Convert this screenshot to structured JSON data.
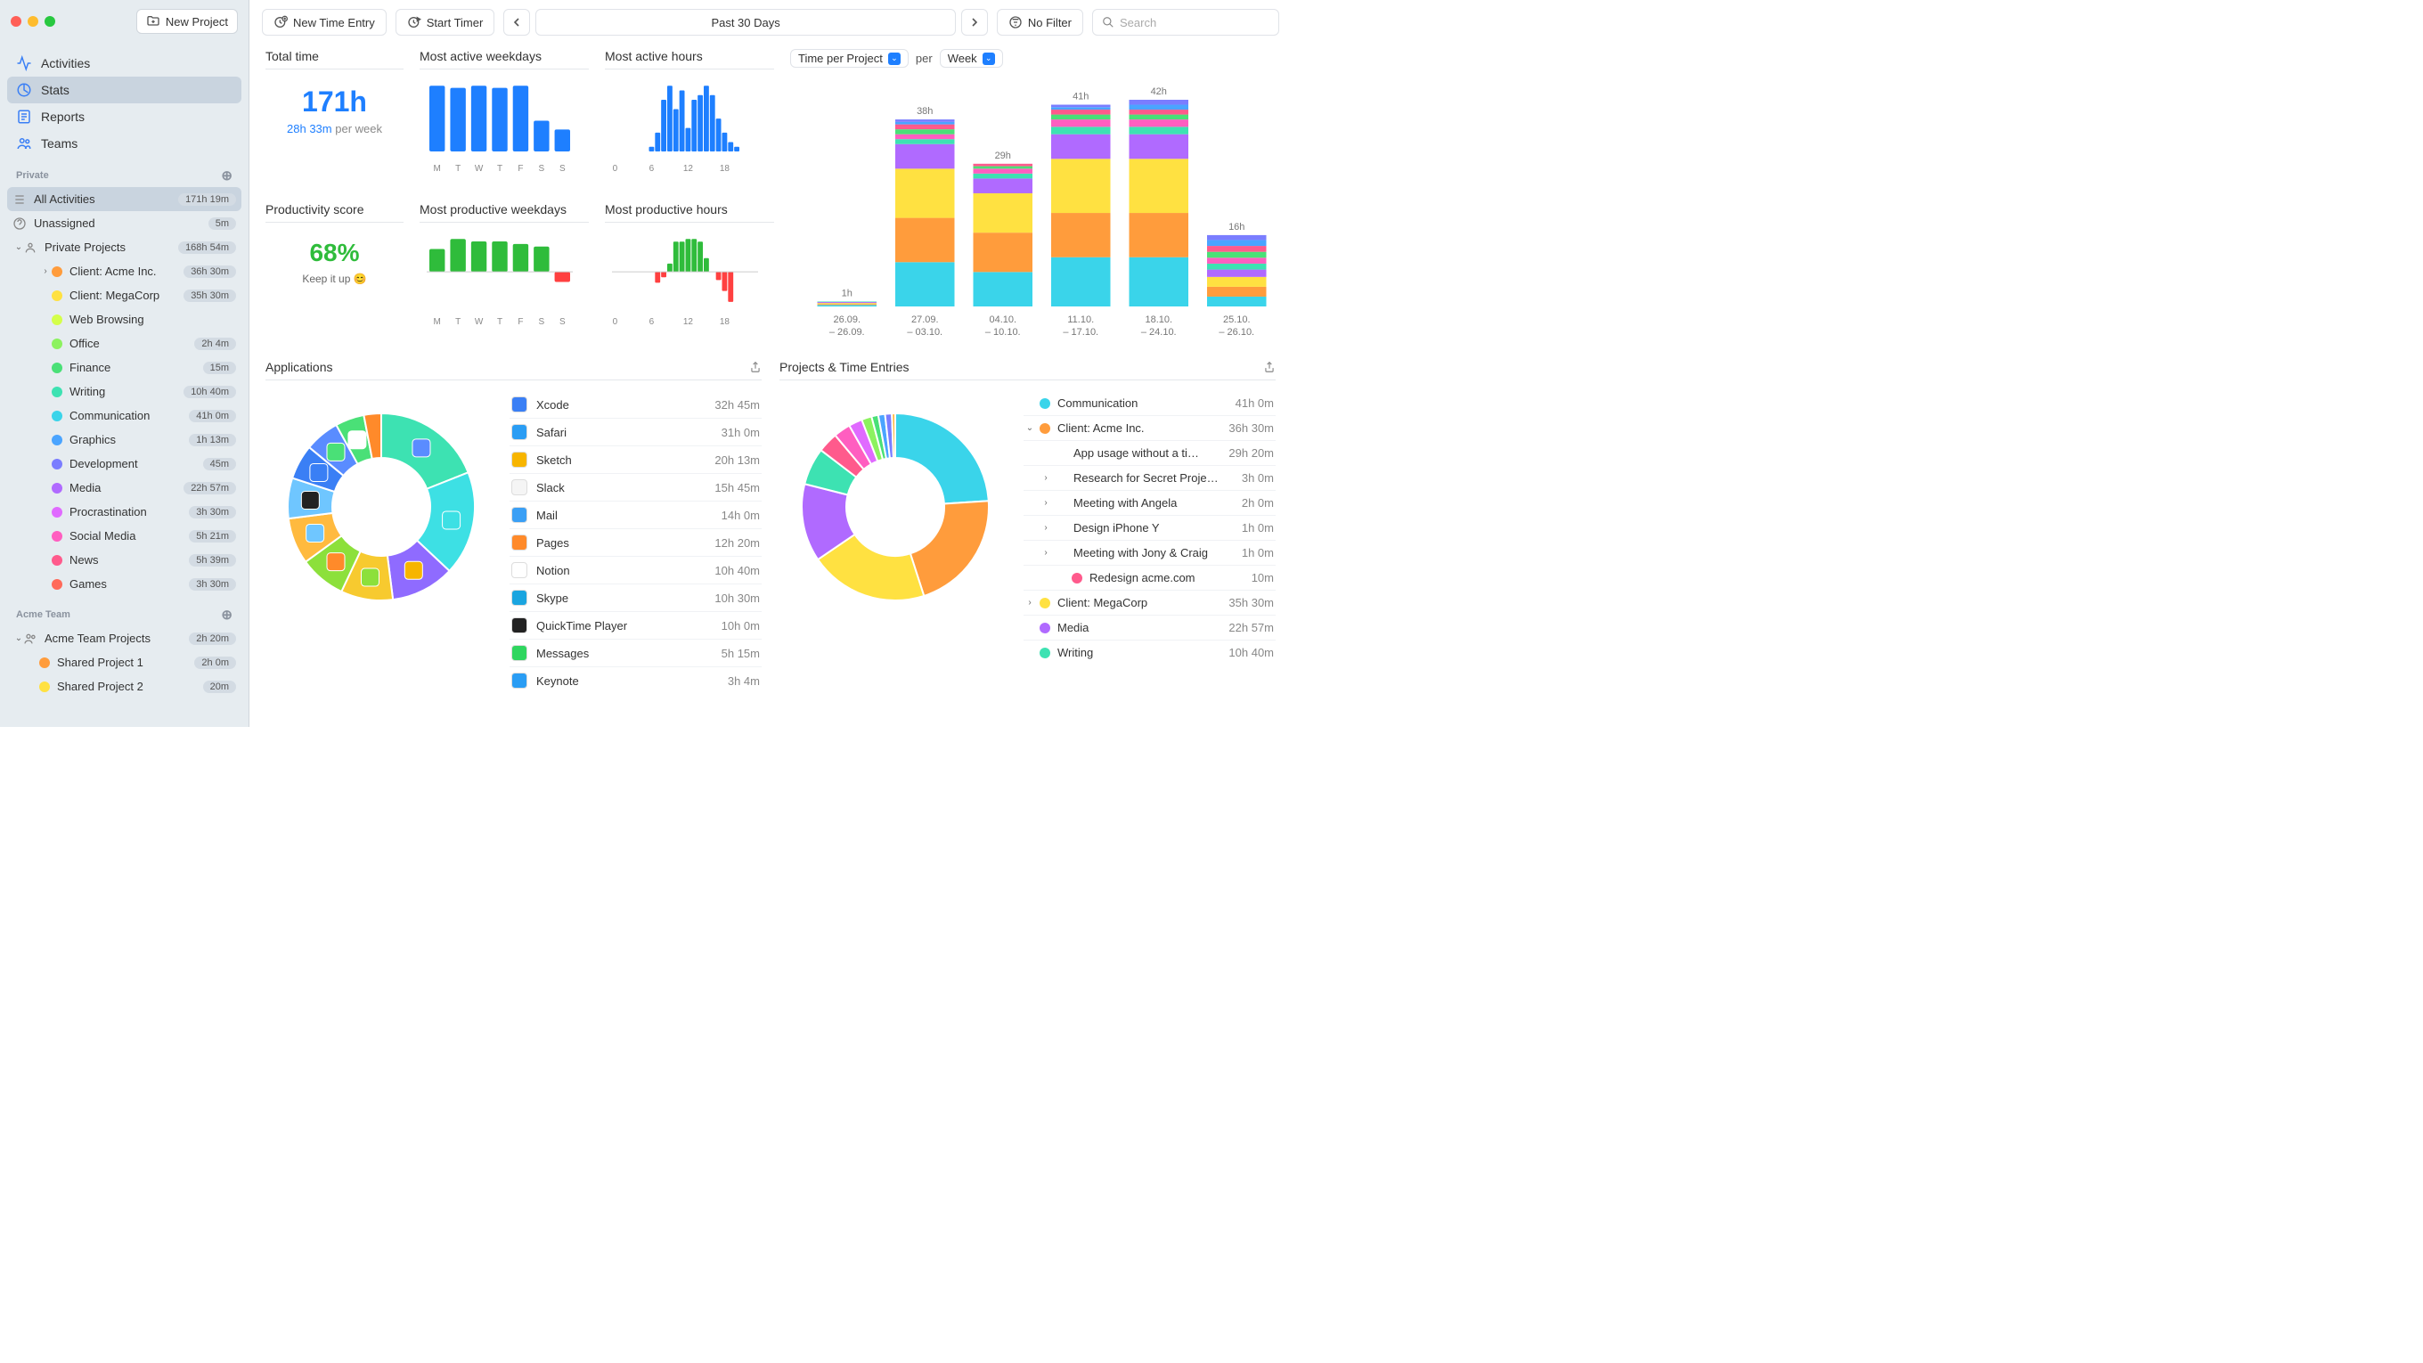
{
  "titlebar": {
    "new_project": "New Project"
  },
  "nav": {
    "activities": "Activities",
    "stats": "Stats",
    "reports": "Reports",
    "teams": "Teams"
  },
  "private": {
    "header": "Private",
    "all_activities": {
      "label": "All Activities",
      "time": "171h 19m"
    },
    "unassigned": {
      "label": "Unassigned",
      "time": "5m"
    },
    "private_projects": {
      "label": "Private Projects",
      "time": "168h 54m"
    },
    "items": [
      {
        "label": "Client: Acme Inc.",
        "time": "36h 30m",
        "color": "#ff9c3c",
        "indent": 2,
        "chev": "›"
      },
      {
        "label": "Client: MegaCorp",
        "time": "35h 30m",
        "color": "#ffe141",
        "indent": 2
      },
      {
        "label": "Web Browsing",
        "time": "",
        "color": "#d4ff4a",
        "indent": 2
      },
      {
        "label": "Office",
        "time": "2h 4m",
        "color": "#8cf25f",
        "indent": 2
      },
      {
        "label": "Finance",
        "time": "15m",
        "color": "#4ae077",
        "indent": 2
      },
      {
        "label": "Writing",
        "time": "10h 40m",
        "color": "#3de2b2",
        "indent": 2
      },
      {
        "label": "Communication",
        "time": "41h 0m",
        "color": "#3ad4ea",
        "indent": 2
      },
      {
        "label": "Graphics",
        "time": "1h 13m",
        "color": "#4aa4ff",
        "indent": 2
      },
      {
        "label": "Development",
        "time": "45m",
        "color": "#7a7dff",
        "indent": 2
      },
      {
        "label": "Media",
        "time": "22h 57m",
        "color": "#b06aff",
        "indent": 2
      },
      {
        "label": "Procrastination",
        "time": "3h 30m",
        "color": "#e06aff",
        "indent": 2
      },
      {
        "label": "Social Media",
        "time": "5h 21m",
        "color": "#ff5ec0",
        "indent": 2
      },
      {
        "label": "News",
        "time": "5h 39m",
        "color": "#ff5a8c",
        "indent": 2
      },
      {
        "label": "Games",
        "time": "3h 30m",
        "color": "#ff6a5a",
        "indent": 2
      }
    ]
  },
  "acme": {
    "header": "Acme Team",
    "projects": {
      "label": "Acme Team Projects",
      "time": "2h 20m"
    },
    "items": [
      {
        "label": "Shared Project 1",
        "time": "2h 0m",
        "color": "#ff9c3c"
      },
      {
        "label": "Shared Project 2",
        "time": "20m",
        "color": "#ffe141"
      }
    ]
  },
  "toolbar": {
    "new_entry": "New Time Entry",
    "start_timer": "Start Timer",
    "date": "Past 30 Days",
    "filter": "No Filter",
    "search_ph": "Search"
  },
  "stats": {
    "total_time_title": "Total time",
    "total_time": "171h",
    "per_week_val": "28h 33m",
    "per_week_lbl": "per week",
    "prod_title": "Productivity score",
    "prod_val": "68%",
    "keep_it": "Keep it up 😊",
    "maw_title": "Most active weekdays",
    "mah_title": "Most active hours",
    "mpw_title": "Most productive weekdays",
    "mph_title": "Most productive hours"
  },
  "chart_data": {
    "maw": {
      "type": "bar",
      "categories": [
        "M",
        "T",
        "W",
        "T",
        "F",
        "S",
        "S"
      ],
      "values": [
        30,
        29,
        30,
        29,
        30,
        14,
        10
      ],
      "color": "#1e7fff"
    },
    "mah": {
      "type": "bar",
      "x": [
        0,
        1,
        2,
        3,
        4,
        5,
        6,
        7,
        8,
        9,
        10,
        11,
        12,
        13,
        14,
        15,
        16,
        17,
        18,
        19,
        20,
        21,
        22,
        23
      ],
      "values": [
        0,
        0,
        0,
        0,
        0,
        0,
        2,
        8,
        22,
        28,
        18,
        26,
        10,
        22,
        24,
        28,
        24,
        14,
        8,
        4,
        2,
        0,
        0,
        0
      ],
      "xticks": [
        0,
        6,
        12,
        18
      ],
      "color": "#1e7fff"
    },
    "mpw": {
      "type": "bar",
      "categories": [
        "M",
        "T",
        "W",
        "T",
        "F",
        "S",
        "S"
      ],
      "values": [
        9,
        13,
        12,
        12,
        11,
        10,
        -4
      ],
      "colors_pos": "#2fbc3b",
      "colors_neg": "#ff4040"
    },
    "mph": {
      "type": "bar",
      "x": [
        0,
        1,
        2,
        3,
        4,
        5,
        6,
        7,
        8,
        9,
        10,
        11,
        12,
        13,
        14,
        15,
        16,
        17,
        18,
        19,
        20,
        21,
        22,
        23
      ],
      "values": [
        0,
        0,
        0,
        0,
        0,
        0,
        0,
        -8,
        -4,
        6,
        22,
        22,
        24,
        24,
        22,
        10,
        0,
        -6,
        -14,
        -22,
        0,
        0,
        0,
        0
      ],
      "xticks": [
        0,
        6,
        12,
        18
      ],
      "colors_pos": "#2fbc3b",
      "colors_neg": "#ff4040"
    },
    "time_per_project": {
      "type": "stacked_bar",
      "dropdown1": "Time per Project",
      "per": "per",
      "dropdown2": "Week",
      "labels_top": [
        "1h",
        "38h",
        "29h",
        "41h",
        "42h",
        "16h"
      ],
      "categories": [
        [
          "26.09.",
          "– 26.09."
        ],
        [
          "27.09.",
          "– 03.10."
        ],
        [
          "04.10.",
          "– 10.10."
        ],
        [
          "11.10.",
          "– 17.10."
        ],
        [
          "18.10.",
          "– 24.10."
        ],
        [
          "25.10.",
          "– 26.10."
        ]
      ],
      "series_colors": [
        "#3ad4ea",
        "#ff9c3c",
        "#ffe141",
        "#b06aff",
        "#3de2b2",
        "#ff5ec0",
        "#4ae077",
        "#ff5a8c",
        "#4aa4ff",
        "#7a7dff"
      ],
      "data": [
        [
          0.3,
          0.2,
          0.2,
          0.2,
          0.1,
          0,
          0,
          0,
          0,
          0
        ],
        [
          9,
          9,
          10,
          5,
          1,
          1,
          1,
          1,
          0.5,
          0.5
        ],
        [
          7,
          8,
          8,
          3,
          1,
          1,
          0.5,
          0.5,
          0,
          0
        ],
        [
          10,
          9,
          11,
          5,
          1.5,
          1.5,
          1,
          1,
          0.5,
          0.5
        ],
        [
          10,
          9,
          11,
          5,
          1.5,
          1.5,
          1,
          1,
          1,
          1
        ],
        [
          2,
          2,
          2,
          1.5,
          1.2,
          1.2,
          1.2,
          1.2,
          1.2,
          1
        ]
      ]
    }
  },
  "apps": {
    "title": "Applications",
    "list": [
      {
        "name": "Xcode",
        "time": "32h 45m",
        "color": "#3a7ff5"
      },
      {
        "name": "Safari",
        "time": "31h 0m",
        "color": "#2a9df4"
      },
      {
        "name": "Sketch",
        "time": "20h 13m",
        "color": "#f7b500"
      },
      {
        "name": "Slack",
        "time": "15h 45m",
        "color": "#f5f5f5"
      },
      {
        "name": "Mail",
        "time": "14h 0m",
        "color": "#3a9ff5"
      },
      {
        "name": "Pages",
        "time": "12h 20m",
        "color": "#ff8a2a"
      },
      {
        "name": "Notion",
        "time": "10h 40m",
        "color": "#ffffff"
      },
      {
        "name": "Skype",
        "time": "10h 30m",
        "color": "#1aa5e0"
      },
      {
        "name": "QuickTime Player",
        "time": "10h 0m",
        "color": "#222"
      },
      {
        "name": "Messages",
        "time": "5h 15m",
        "color": "#2fd65f"
      },
      {
        "name": "Keynote",
        "time": "3h 4m",
        "color": "#2a9df4"
      }
    ],
    "donut_colors": [
      "#3de2b2",
      "#3de0e4",
      "#8f6bff",
      "#f7ca2f",
      "#8ce03b",
      "#ffba3f",
      "#6fc6ff",
      "#3a7ff5",
      "#5a8cff",
      "#4ae077",
      "#ff8a2a"
    ],
    "donut_values": [
      19,
      18,
      11,
      9,
      8,
      8,
      7,
      6,
      6,
      5,
      3
    ]
  },
  "proj": {
    "title": "Projects & Time Entries",
    "list": [
      {
        "chev": "",
        "color": "#3ad4ea",
        "label": "Communication",
        "time": "41h 0m",
        "indent": 0
      },
      {
        "chev": "⌄",
        "color": "#ff9c3c",
        "label": "Client: Acme Inc.",
        "time": "36h 30m",
        "indent": 0
      },
      {
        "chev": "",
        "color": "",
        "label": "App usage without a ti…",
        "time": "29h 20m",
        "indent": 1
      },
      {
        "chev": "›",
        "color": "",
        "label": "Research for Secret Proje…",
        "time": "3h 0m",
        "indent": 1
      },
      {
        "chev": "›",
        "color": "",
        "label": "Meeting with Angela",
        "time": "2h 0m",
        "indent": 1
      },
      {
        "chev": "›",
        "color": "",
        "label": "Design iPhone Y",
        "time": "1h 0m",
        "indent": 1
      },
      {
        "chev": "›",
        "color": "",
        "label": "Meeting with Jony & Craig",
        "time": "1h 0m",
        "indent": 1
      },
      {
        "chev": "",
        "color": "#ff5a8c",
        "label": "Redesign acme.com",
        "time": "10m",
        "indent": 2
      },
      {
        "chev": "›",
        "color": "#ffe141",
        "label": "Client: MegaCorp",
        "time": "35h 30m",
        "indent": 0
      },
      {
        "chev": "",
        "color": "#b06aff",
        "label": "Media",
        "time": "22h 57m",
        "indent": 0
      },
      {
        "chev": "",
        "color": "#3de2b2",
        "label": "Writing",
        "time": "10h 40m",
        "indent": 0
      }
    ],
    "donut_colors": [
      "#3ad4ea",
      "#ff9c3c",
      "#ffe141",
      "#b06aff",
      "#3de2b2",
      "#ff5a8c",
      "#ff5ec0",
      "#e06aff",
      "#8cf25f",
      "#4ae077",
      "#4aa4ff",
      "#7a7dff",
      "#ffb63c"
    ],
    "donut_values": [
      41,
      36,
      35,
      23,
      11,
      6,
      5,
      4,
      3,
      2,
      2,
      2,
      1
    ]
  }
}
